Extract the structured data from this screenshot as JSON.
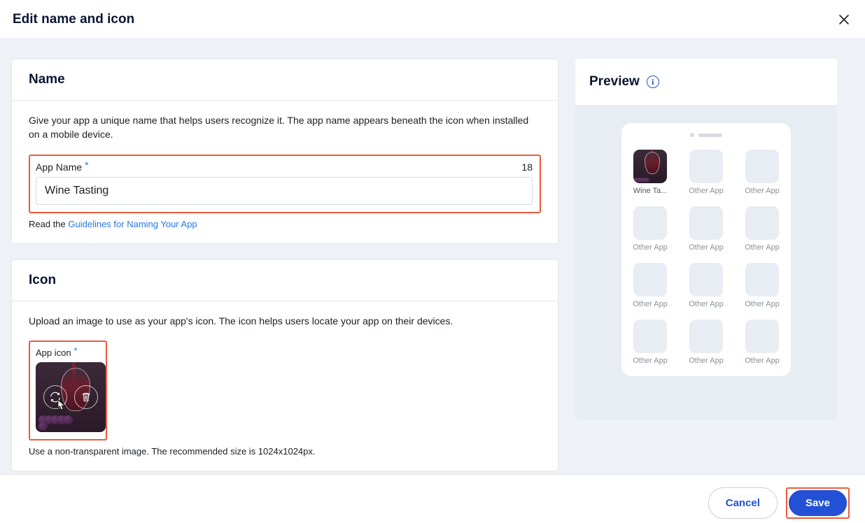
{
  "header": {
    "title": "Edit name and icon"
  },
  "name_section": {
    "heading": "Name",
    "description": "Give your app a unique name that helps users recognize it. The app name appears beneath the icon when installed on a mobile device.",
    "field_label": "App Name",
    "char_count": "18",
    "value": "Wine Tasting",
    "helper_prefix": "Read the ",
    "helper_link": "Guidelines for Naming Your App"
  },
  "icon_section": {
    "heading": "Icon",
    "description": "Upload an image to use as your app's icon. The icon helps users locate your app on their devices.",
    "field_label": "App icon",
    "helper": "Use a non-transparent image. The recommended size is 1024x1024px."
  },
  "preview": {
    "heading": "Preview",
    "featured_label": "Wine Ta...",
    "other_label": "Other App"
  },
  "footer": {
    "cancel": "Cancel",
    "save": "Save"
  }
}
